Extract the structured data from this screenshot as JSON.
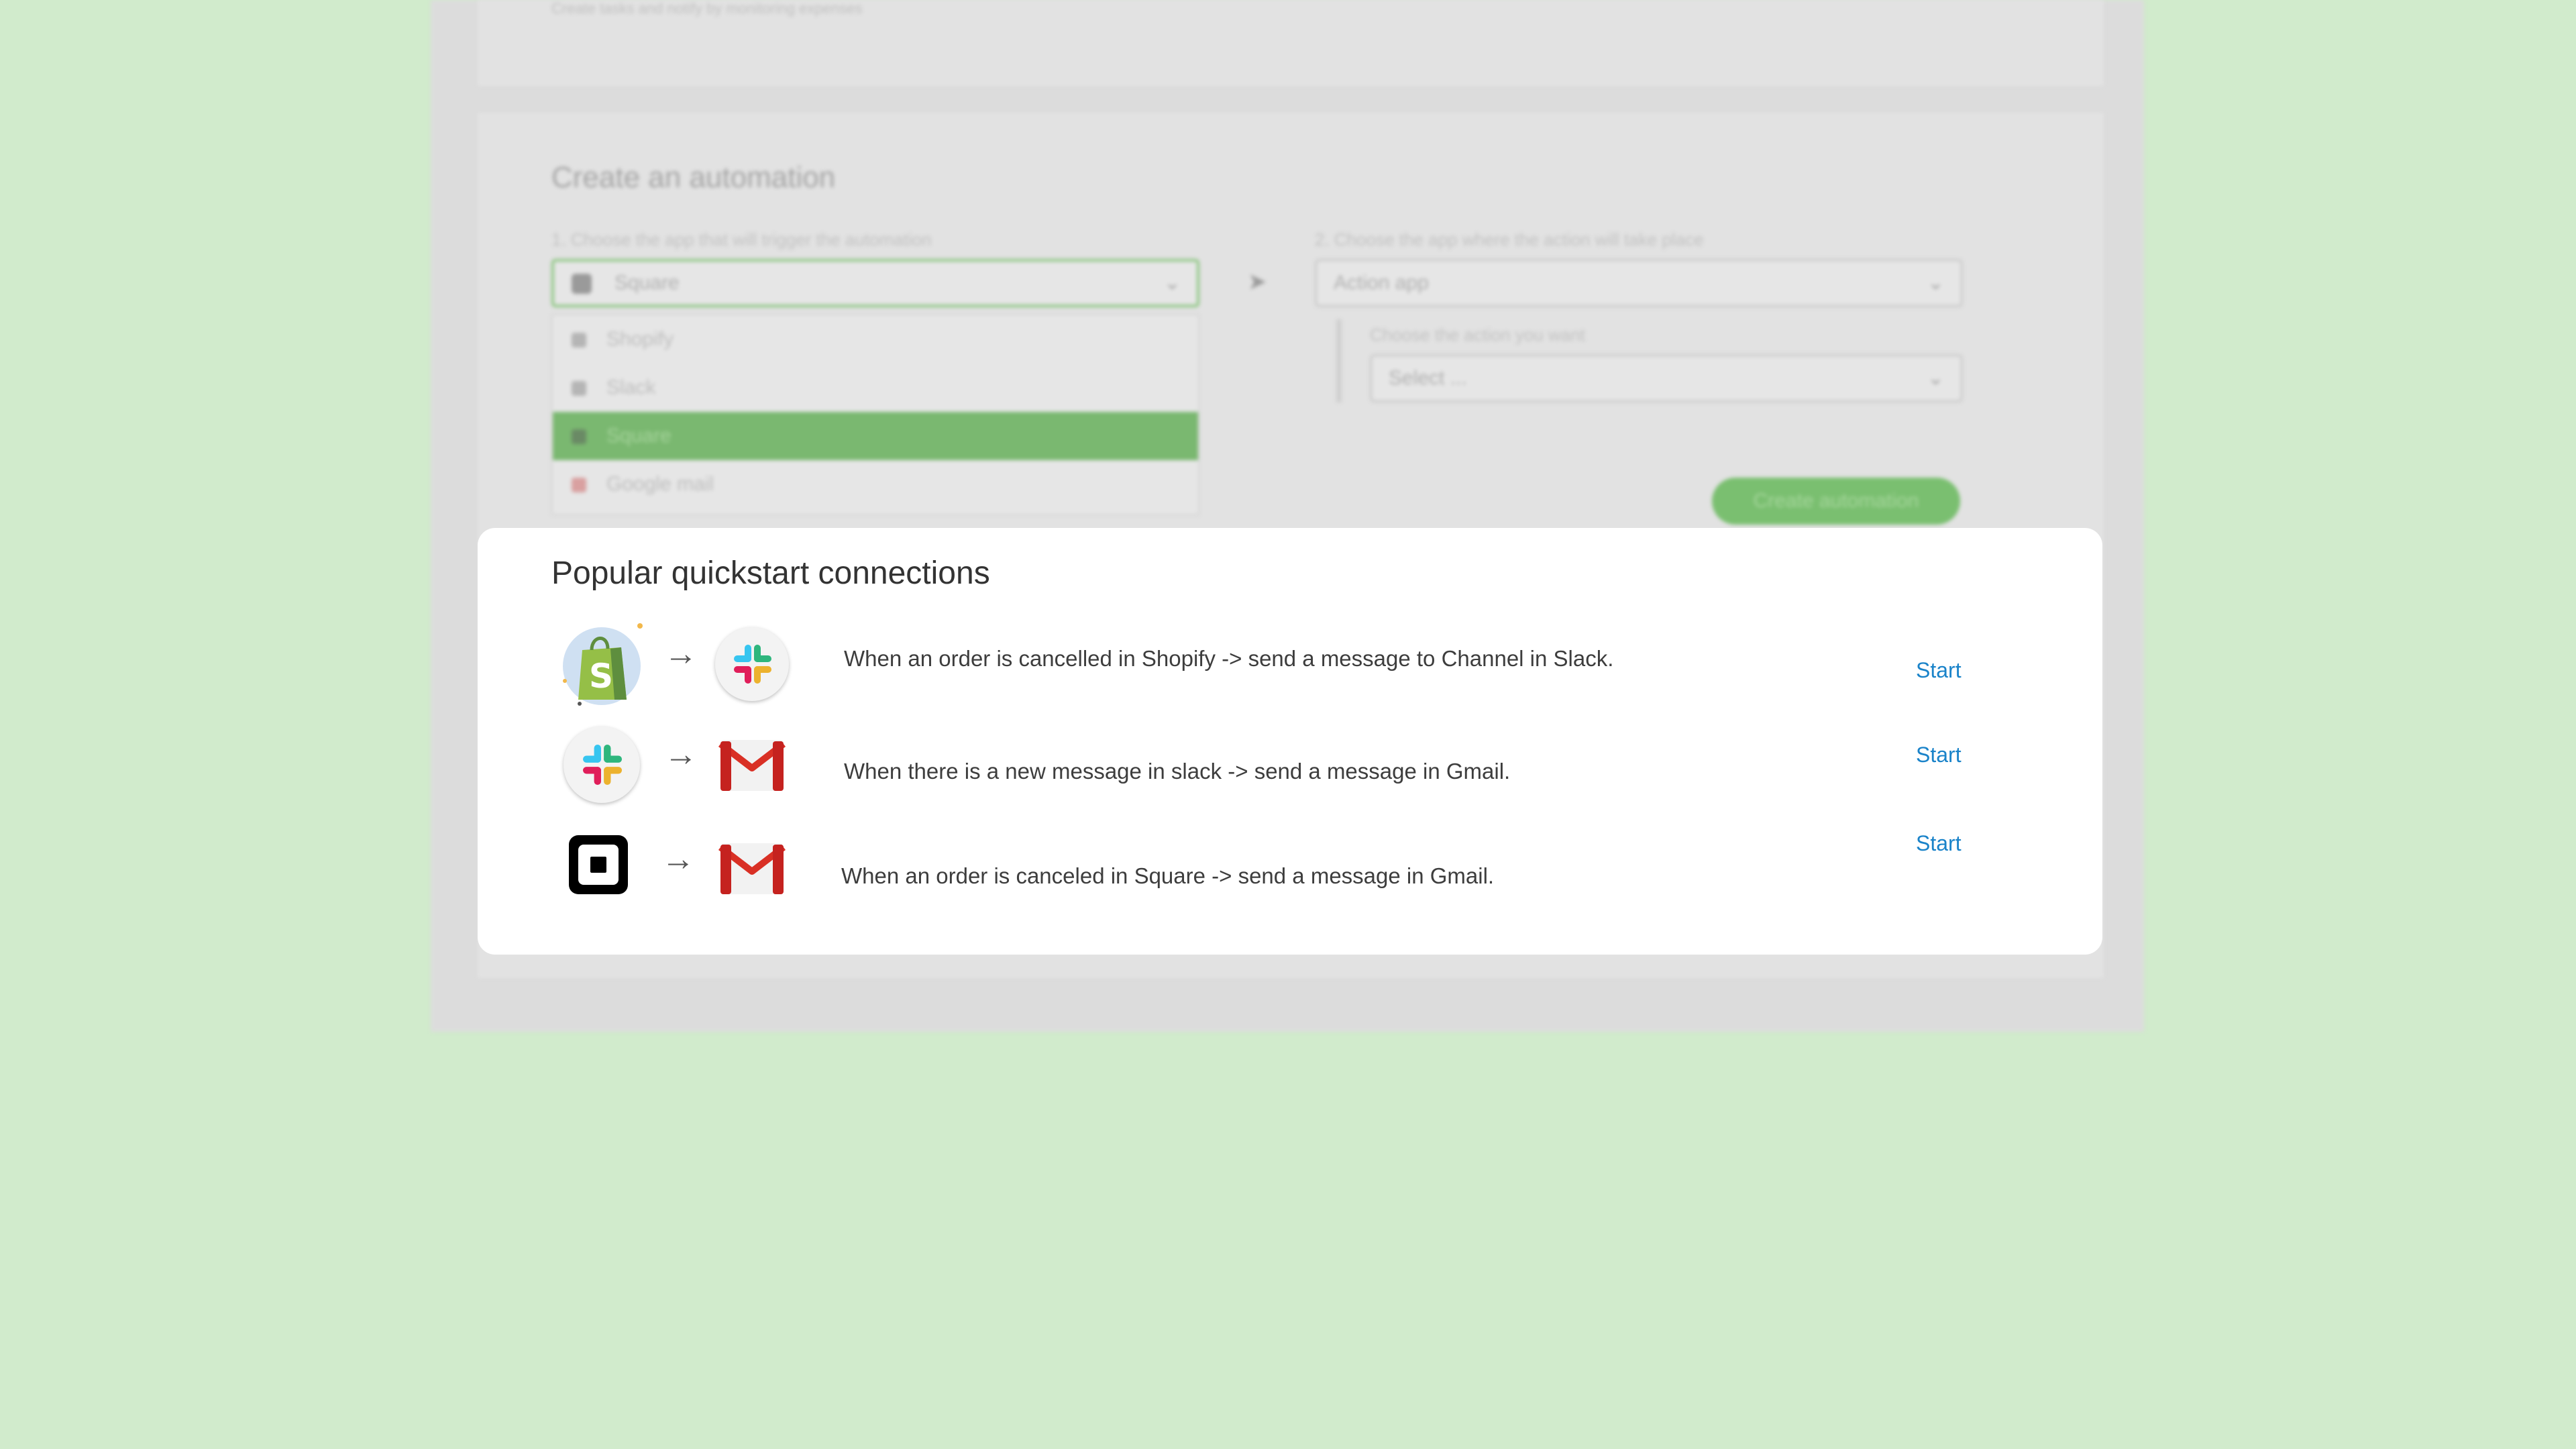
{
  "background": {
    "top_text": "Create tasks and notify by monitoring expenses",
    "section_title": "Create an automation",
    "trigger_label": "1. Choose the app that will trigger the automation",
    "trigger_value": "Square",
    "action_label": "2. Choose the app where the action will take place",
    "action_value": "Action app",
    "subaction_label": "Choose the action you want",
    "subaction_value": "Select ...",
    "dropdown_options": [
      "Shopify",
      "Slack",
      "Square",
      "Google mail"
    ],
    "selected_option": "Square",
    "create_button": "Create automation"
  },
  "panel": {
    "title": "Popular quickstart connections",
    "rows": [
      {
        "source_icon": "shopify-icon",
        "target_icon": "slack-icon",
        "description": "When an order is cancelled in Shopify -> send a message to Channel in Slack.",
        "action": "Start"
      },
      {
        "source_icon": "slack-icon",
        "target_icon": "gmail-icon",
        "description": "When there is a new message in slack -> send a message in Gmail.",
        "action": "Start"
      },
      {
        "source_icon": "square-icon",
        "target_icon": "gmail-icon",
        "description": "When an order is canceled in Square -> send a message in Gmail.",
        "action": "Start"
      }
    ]
  },
  "colors": {
    "page_background": "#d1ebcc",
    "link": "#1a83c9",
    "accent_green": "#7ab870"
  }
}
